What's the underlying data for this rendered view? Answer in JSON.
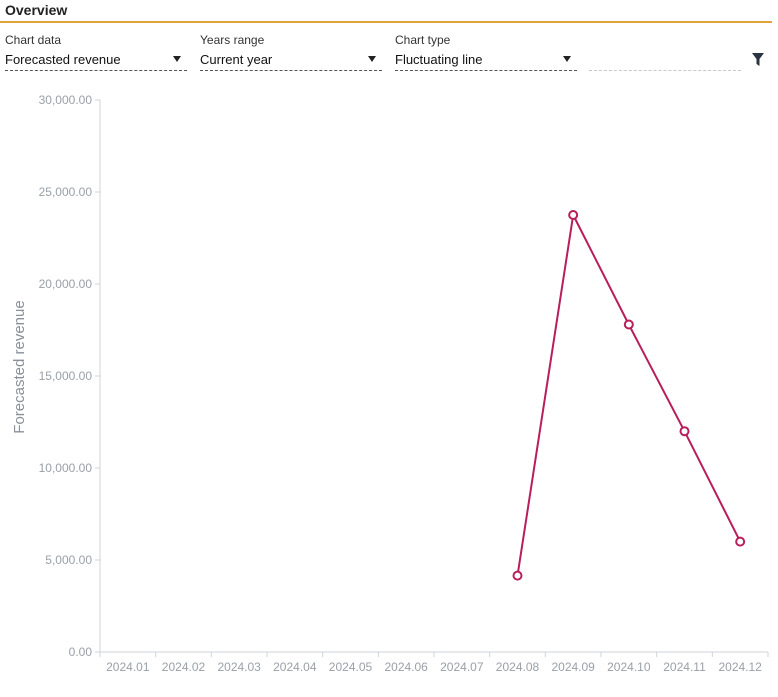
{
  "header": {
    "title": "Overview"
  },
  "filters": {
    "chart_data": {
      "label": "Chart data",
      "value": "Forecasted revenue"
    },
    "years_range": {
      "label": "Years range",
      "value": "Current year"
    },
    "chart_type": {
      "label": "Chart type",
      "value": "Fluctuating line"
    }
  },
  "icons": {
    "filter": "filter-funnel-icon",
    "dropdown": "caret-down-icon"
  },
  "colors": {
    "accent_border": "#e0a43a",
    "series_line": "#b81e5c",
    "axis_text": "#9aa0a8"
  },
  "chart_data": {
    "type": "line",
    "title": "",
    "xlabel": "",
    "ylabel": "Forecasted revenue",
    "x": [
      "2024.01",
      "2024.02",
      "2024.03",
      "2024.04",
      "2024.05",
      "2024.06",
      "2024.07",
      "2024.08",
      "2024.09",
      "2024.10",
      "2024.11",
      "2024.12"
    ],
    "ylim": [
      0,
      30000
    ],
    "yticks": [
      "0.00",
      "5,000.00",
      "10,000.00",
      "15,000.00",
      "20,000.00",
      "25,000.00",
      "30,000.00"
    ],
    "series": [
      {
        "values": [
          null,
          null,
          null,
          null,
          null,
          null,
          null,
          4150,
          23750,
          17800,
          12000,
          6000
        ],
        "color": "#b81e5c",
        "markers": "open-circle"
      }
    ],
    "grid": false,
    "legend": "none"
  }
}
